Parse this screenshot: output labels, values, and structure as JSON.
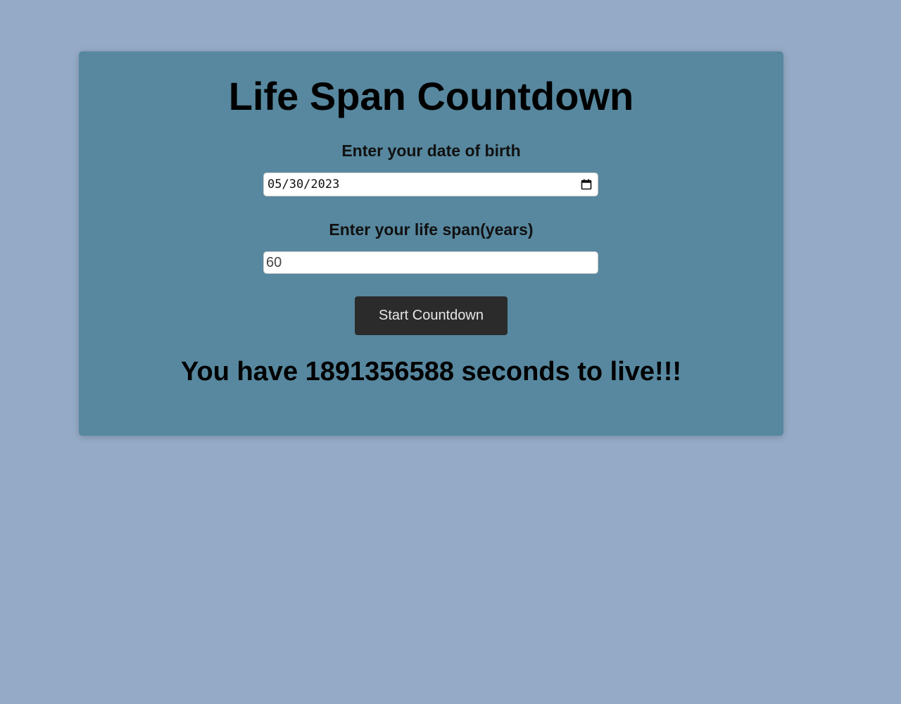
{
  "app": {
    "title": "Life Span Countdown"
  },
  "form": {
    "dob_label": "Enter your date of birth",
    "dob_value": "05/30/2023",
    "lifespan_label": "Enter your life span(years)",
    "lifespan_value": "60",
    "start_button_label": "Start Countdown"
  },
  "result": {
    "text": "You have 1891356588 seconds to live!!!"
  },
  "icons": {
    "date_picker": "calendar-icon"
  },
  "colors": {
    "page_background": "#95aac6",
    "card_background": "#57889f",
    "button_background": "#2b2b2b",
    "button_text": "#e8e8e8"
  }
}
